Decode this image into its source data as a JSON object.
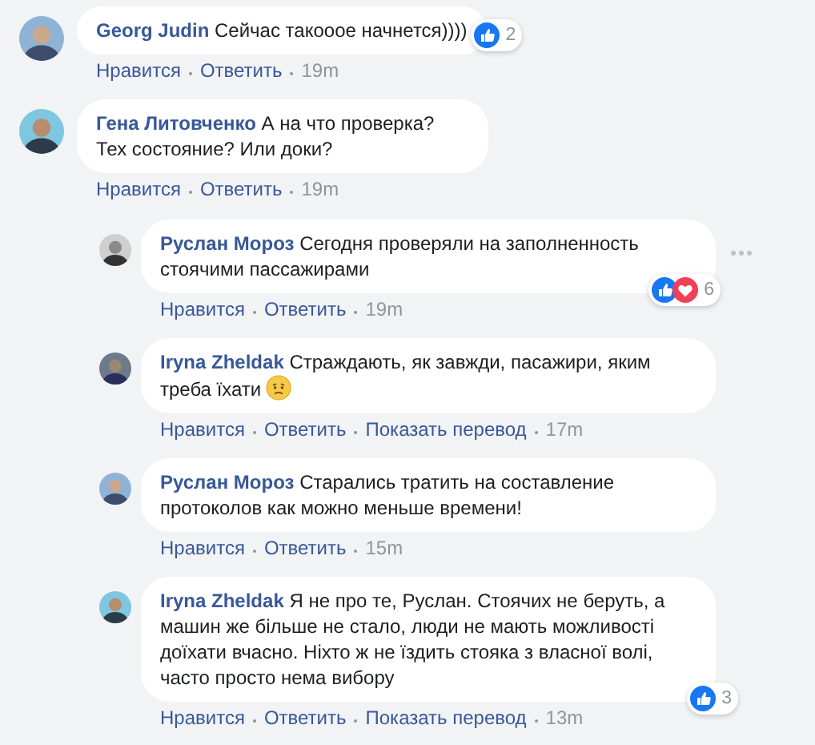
{
  "comments": [
    {
      "author": "Georg Judin",
      "text": "Сейчас такооое начнется))))",
      "reactions": [
        {
          "kind": "like"
        }
      ],
      "reaction_count": "2",
      "actions": [
        "Нравится",
        "Ответить"
      ],
      "time": "19m"
    },
    {
      "author": "Гена Литовченко",
      "text": "А на что проверка? Тех состояние? Или доки?",
      "actions": [
        "Нравится",
        "Ответить"
      ],
      "time": "19m",
      "children": [
        {
          "author": "Руслан Мороз",
          "text": "Сегодня проверяли на заполненность стоячими пассажирами",
          "menu": true,
          "reactions": [
            {
              "kind": "like"
            },
            {
              "kind": "love"
            }
          ],
          "reaction_count": "6",
          "actions": [
            "Нравится",
            "Ответить"
          ],
          "time": "19m"
        },
        {
          "author": "Iryna Zheldak",
          "text": "Страждають, як завжди, пасажири, яким треба їхати",
          "emoji_after": true,
          "actions": [
            "Нравится",
            "Ответить",
            "Показать перевод"
          ],
          "time": "17m"
        },
        {
          "author": "Руслан Мороз",
          "text": "Старались тратить на составление протоколов как можно меньше времени!",
          "actions": [
            "Нравится",
            "Ответить"
          ],
          "time": "15m"
        },
        {
          "author": "Iryna Zheldak",
          "text": "Я не про те, Руслан. Стоячих не беруть, а машин же більше не стало, люди не мають можливості доїхати вчасно. Ніхто ж не їздить стояка з власної волі, часто просто нема вибору",
          "reactions": [
            {
              "kind": "like"
            }
          ],
          "reaction_count": "3",
          "actions": [
            "Нравится",
            "Ответить",
            "Показать перевод"
          ],
          "time": "13m"
        }
      ]
    }
  ]
}
